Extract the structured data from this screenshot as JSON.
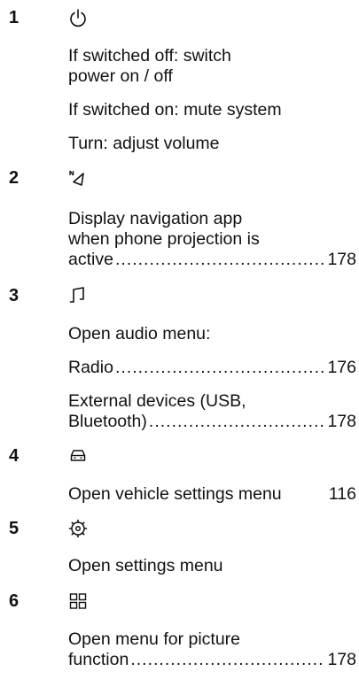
{
  "items": [
    {
      "number": "1",
      "icon": "power-icon",
      "entries": [
        {
          "lines": [
            "If switched off: switch",
            "power on / off"
          ]
        },
        {
          "lines": [
            "If switched on: mute system"
          ]
        },
        {
          "lines": [
            "Turn: adjust volume"
          ]
        }
      ]
    },
    {
      "number": "2",
      "icon": "navigation-icon",
      "entries": [
        {
          "lines": [
            "Display navigation app",
            "when phone projection is",
            "active"
          ],
          "page": "178"
        }
      ]
    },
    {
      "number": "3",
      "icon": "music-note-icon",
      "entries": [
        {
          "lines": [
            "Open audio menu:"
          ]
        },
        {
          "lines": [
            "Radio"
          ],
          "page": "176"
        },
        {
          "lines": [
            "External devices (USB,",
            "Bluetooth)"
          ],
          "page": "178"
        }
      ]
    },
    {
      "number": "4",
      "icon": "car-icon",
      "entries": [
        {
          "lines": [
            "Open vehicle settings menu"
          ],
          "page": "116"
        }
      ]
    },
    {
      "number": "5",
      "icon": "settings-gear-icon",
      "entries": [
        {
          "lines": [
            "Open settings menu"
          ]
        }
      ]
    },
    {
      "number": "6",
      "icon": "grid-icon",
      "entries": [
        {
          "lines": [
            "Open menu for picture",
            "function"
          ],
          "page": "178"
        }
      ]
    }
  ],
  "leader_dots": "........................................................................................................"
}
